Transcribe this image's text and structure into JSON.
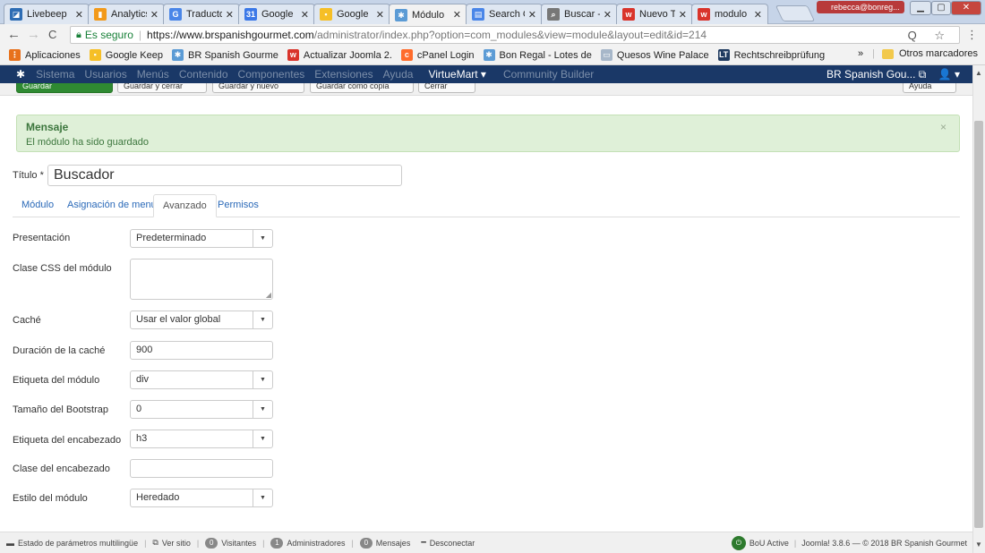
{
  "browser": {
    "tabs": [
      {
        "label": "Livebeep",
        "icon": "livebeep-icon",
        "color": "#2e6db4"
      },
      {
        "label": "Analytics",
        "icon": "analytics-icon",
        "color": "#f29a1b"
      },
      {
        "label": "Traducto",
        "icon": "translate-icon",
        "color": "#4a86e8"
      },
      {
        "label": "Google",
        "icon": "calendar-icon",
        "color": "#3b78e7"
      },
      {
        "label": "Google",
        "icon": "keep-icon",
        "color": "#f6bf26"
      },
      {
        "label": "Módulo",
        "icon": "joomla-icon",
        "color": "#5b9bd5"
      },
      {
        "label": "Search C",
        "icon": "search-console-icon",
        "color": "#4a86e8"
      },
      {
        "label": "Buscar -",
        "icon": "search-icon",
        "color": "#777777"
      },
      {
        "label": "Nuevo T",
        "icon": "wufoo-icon",
        "color": "#d9342b"
      },
      {
        "label": "modulo",
        "icon": "wufoo-icon",
        "color": "#d9342b"
      }
    ],
    "user_chip": "rebecca@bonreg...",
    "nav": {
      "back": "←",
      "forward": "→",
      "reload": "C"
    },
    "secure_label": "Es seguro",
    "url_host": "https://www.brspanishgourmet.com",
    "url_path": "/administrator/index.php?option=com_modules&view=module&layout=edit&id=214",
    "omni_icons": "Q ☆",
    "bookmarks": [
      {
        "label": "Aplicaciones",
        "icon": "apps-icon",
        "color": "#e8711c"
      },
      {
        "label": "Google Keep",
        "icon": "keep-icon",
        "color": "#f6bf26"
      },
      {
        "label": "BR Spanish Gourme",
        "icon": "joomla-icon",
        "color": "#5b9bd5"
      },
      {
        "label": "Actualizar Joomla 2.",
        "icon": "wufoo-icon",
        "color": "#d9342b"
      },
      {
        "label": "cPanel Login",
        "icon": "cpanel-icon",
        "color": "#ff6c2c"
      },
      {
        "label": "Bon Regal - Lotes de",
        "icon": "joomla-icon",
        "color": "#5b9bd5"
      },
      {
        "label": "Quesos Wine Palace",
        "icon": "page-icon",
        "color": "#a7b7c9"
      },
      {
        "label": "Rechtschreibprüfung",
        "icon": "lt-icon",
        "color": "#1f3a60"
      }
    ],
    "bookmarks_more": "»",
    "other_bookmarks": "Otros marcadores"
  },
  "admin_nav": {
    "items": [
      "Sistema",
      "Usuarios",
      "Menús",
      "Contenido",
      "Componentes",
      "Extensiones",
      "Ayuda"
    ],
    "virtuemart": "VirtueMart ▾",
    "community": "Community Builder",
    "site": "BR Spanish Gou... ⧉",
    "user": "👤 ▾"
  },
  "toolbar": {
    "save": "Guardar",
    "save_close": "Guardar y cerrar",
    "save_new": "Guardar y nuevo",
    "save_copy": "Guardar como copia",
    "close": "Cerrar",
    "help": "Ayuda"
  },
  "message": {
    "heading": "Mensaje",
    "body": "El módulo ha sido guardado",
    "close": "×"
  },
  "title_field": {
    "label": "Título *",
    "value": "Buscador"
  },
  "tabs": [
    "Módulo",
    "Asignación de menú",
    "Avanzado",
    "Permisos"
  ],
  "form": {
    "layout": {
      "label": "Presentación",
      "value": "Predeterminado"
    },
    "css_class": {
      "label": "Clase CSS del módulo",
      "value": ""
    },
    "cache": {
      "label": "Caché",
      "value": "Usar el valor global"
    },
    "cache_time": {
      "label": "Duración de la caché",
      "value": "900"
    },
    "module_tag": {
      "label": "Etiqueta del módulo",
      "value": "div"
    },
    "bootstrap_size": {
      "label": "Tamaño del Bootstrap",
      "value": "0"
    },
    "header_tag": {
      "label": "Etiqueta del encabezado",
      "value": "h3"
    },
    "header_class": {
      "label": "Clase del encabezado",
      "value": ""
    },
    "module_style": {
      "label": "Estilo del módulo",
      "value": "Heredado"
    }
  },
  "statusbar": {
    "multilang": "Estado de parámetros multilingüe",
    "view_site": "Ver sitio",
    "visitors_count": "0",
    "visitors": "Visitantes",
    "admins_count": "1",
    "admins": "Administradores",
    "messages_count": "0",
    "messages": "Mensajes",
    "logout": "Desconectar",
    "bou": "BoU Active",
    "version": "Joomla! 3.8.6 — © 2018 BR Spanish Gourmet"
  }
}
